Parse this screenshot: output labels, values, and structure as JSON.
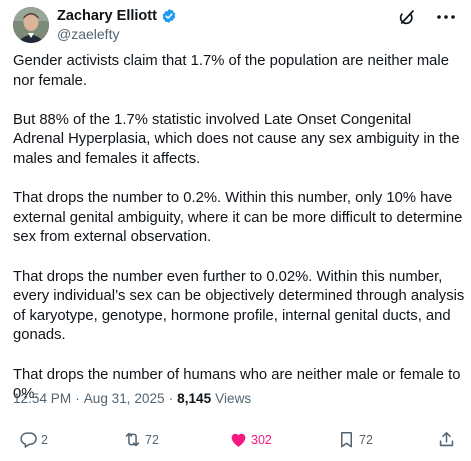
{
  "author": {
    "display_name": "Zachary Elliott",
    "handle": "@zaelefty",
    "verified": true
  },
  "tweet": {
    "paragraphs": [
      "Gender activists claim that 1.7% of the population are neither male nor female.",
      "But 88% of the 1.7% statistic involved Late Onset Congenital Adrenal Hyperplasia, which does not cause any sex ambiguity in the males and females it affects.",
      "That drops the number to 0.2%. Within this number, only 10% have external genital ambiguity, where it can be more difficult to determine sex from external observation.",
      "That drops the number even further to 0.02%. Within this number, every individual’s sex can be objectively determined through analysis of karyotype, genotype, hormone profile, internal genital ducts, and gonads.",
      "That drops the number of humans who are neither male or female to 0%."
    ],
    "time": "12:54 PM",
    "separator": "·",
    "date": "Aug 31, 2025",
    "views_count": "8,145",
    "views_label": "Views"
  },
  "actions": {
    "replies": "2",
    "reposts": "72",
    "likes": "302",
    "bookmarks": "72"
  },
  "icons": {
    "verified": "verified-badge-icon",
    "grok": "grok-icon",
    "more": "more-icon",
    "reply": "reply-icon",
    "repost": "repost-icon",
    "like": "heart-icon",
    "bookmark": "bookmark-icon",
    "share": "share-icon"
  },
  "colors": {
    "text_primary": "#0f1419",
    "text_secondary": "#536471",
    "verified_blue": "#1d9bf0",
    "like_pink": "#f91880"
  }
}
